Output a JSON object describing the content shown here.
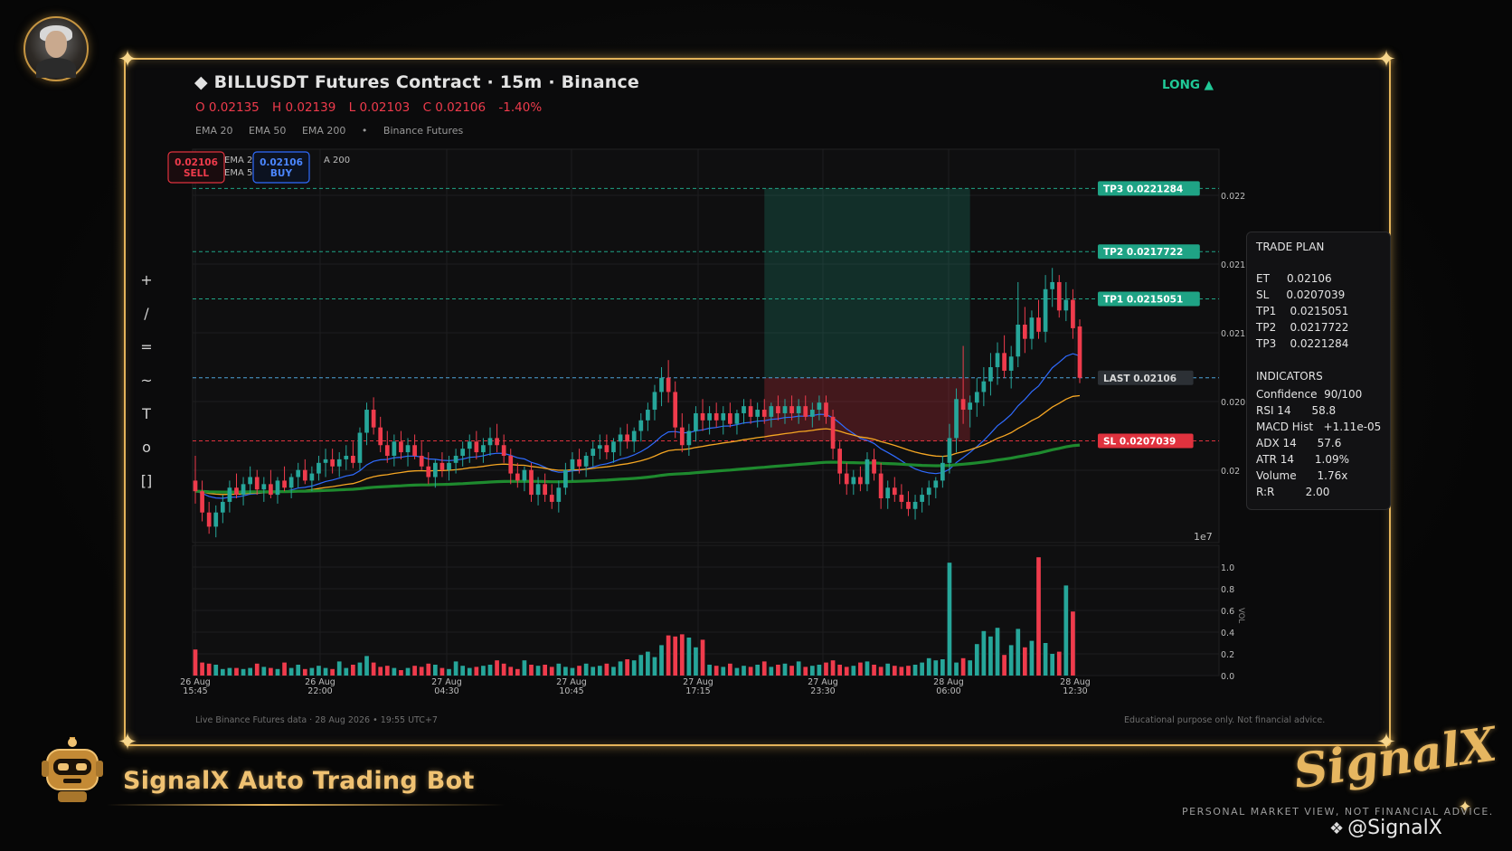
{
  "header": {
    "symbol_icon": "diamond-icon",
    "title": "◆  BILLUSDT Futures Contract  ·  15m  ·  Binance",
    "ohlc": {
      "open": "O 0.02135",
      "high": "H 0.02139",
      "low": "L 0.02103",
      "close": "C 0.02106",
      "change": "-1.40%"
    },
    "indicators": [
      "EMA 20",
      "EMA 50",
      "EMA 200",
      "•",
      "Binance Futures"
    ],
    "direction": "LONG  ▲"
  },
  "order_buttons": {
    "sell_price": "0.02106",
    "sell_label": "SELL",
    "buy_price": "0.02106",
    "buy_label": "BUY"
  },
  "legend_behind": [
    "EMA 2",
    "EMA 5",
    "A 200"
  ],
  "toolbar": [
    "+",
    "/",
    "=",
    "~",
    "T",
    "o",
    "[]"
  ],
  "levels": {
    "tp3": {
      "label": "TP3  0.0221284",
      "value": 0.0221284
    },
    "tp2": {
      "label": "TP2  0.0217722",
      "value": 0.0217722
    },
    "tp1": {
      "label": "TP1  0.0215051",
      "value": 0.0215051
    },
    "last": {
      "label": "LAST  0.02106",
      "value": 0.02106
    },
    "sl": {
      "label": "SL  0.0207039",
      "value": 0.0207039
    }
  },
  "trade_plan": {
    "title": "TRADE PLAN",
    "rows": [
      "ET     0.02106",
      "SL     0.0207039",
      "TP1    0.0215051",
      "TP2    0.0217722",
      "TP3    0.0221284"
    ],
    "indicators_title": "INDICATORS",
    "indicator_rows": [
      "Confidence  90/100",
      "RSI 14      58.8",
      "MACD Hist   +1.11e-05",
      "ADX 14      57.6",
      "ATR 14      1.09%",
      "Volume      1.76x",
      "R:R         2.00"
    ]
  },
  "footer": {
    "left": "Live Binance Futures data  ·  28 Aug 2026 • 19:55 UTC+7",
    "right": "Educational purpose only. Not financial advice."
  },
  "branding": {
    "icon": "robot-icon",
    "name": "SignalX Auto Trading Bot",
    "logo": "SignalX",
    "disclaimer": "PERSONAL MARKET VIEW, NOT FINANCIAL ADVICE.",
    "handle_icon": "binance-diamond-icon",
    "handle": "@SignalX"
  },
  "colors": {
    "up": "#26a69a",
    "down": "#ef3b4c",
    "ema20": "#2f6bff",
    "ema50": "#f5a623",
    "ema200": "#1e8a2e",
    "gold": "#e4b35a",
    "tp": "#1fa385",
    "sl": "#e0323e"
  },
  "chart_data": {
    "type": "candlestick",
    "title": "BILLUSDT Futures Contract · 15m · Binance",
    "x_tick_labels": [
      "26 Aug\n15:45",
      "26 Aug\n22:00",
      "27 Aug\n04:30",
      "27 Aug\n10:45",
      "27 Aug\n17:15",
      "27 Aug\n23:30",
      "28 Aug\n06:00",
      "28 Aug\n12:30"
    ],
    "y_tick_labels": [
      "0.022",
      "0.021",
      "0.021",
      "0.020",
      "0.02"
    ],
    "y_offset_label": "1e7",
    "y_range": [
      0.02013,
      0.02235
    ],
    "volume_ylabel": "VOL",
    "volume_tick_labels": [
      "1.0",
      "0.8",
      "0.6",
      "0.4",
      "0.2",
      "0.0"
    ],
    "volume_range": [
      0,
      1.0
    ],
    "position_box": {
      "entry": 0.02106,
      "stop": 0.0207039,
      "target": 0.0221284,
      "start_index": 83,
      "end_index": 113
    },
    "candles": [
      {
        "o": 0.02048,
        "h": 0.02062,
        "l": 0.02035,
        "c": 0.02042
      },
      {
        "o": 0.02042,
        "h": 0.02048,
        "l": 0.02025,
        "c": 0.0203
      },
      {
        "o": 0.0203,
        "h": 0.02036,
        "l": 0.02018,
        "c": 0.02022
      },
      {
        "o": 0.02022,
        "h": 0.02034,
        "l": 0.02016,
        "c": 0.0203
      },
      {
        "o": 0.0203,
        "h": 0.0204,
        "l": 0.02024,
        "c": 0.02036
      },
      {
        "o": 0.02036,
        "h": 0.02048,
        "l": 0.0203,
        "c": 0.02044
      },
      {
        "o": 0.02044,
        "h": 0.02052,
        "l": 0.02038,
        "c": 0.0204
      },
      {
        "o": 0.0204,
        "h": 0.0205,
        "l": 0.02034,
        "c": 0.02046
      },
      {
        "o": 0.02046,
        "h": 0.02056,
        "l": 0.0204,
        "c": 0.0205
      },
      {
        "o": 0.0205,
        "h": 0.02054,
        "l": 0.0204,
        "c": 0.02043
      },
      {
        "o": 0.02043,
        "h": 0.0205,
        "l": 0.02036,
        "c": 0.02046
      },
      {
        "o": 0.02046,
        "h": 0.02054,
        "l": 0.02038,
        "c": 0.0204
      },
      {
        "o": 0.0204,
        "h": 0.0205,
        "l": 0.02035,
        "c": 0.02048
      },
      {
        "o": 0.02048,
        "h": 0.02056,
        "l": 0.02042,
        "c": 0.02044
      },
      {
        "o": 0.02044,
        "h": 0.02052,
        "l": 0.02038,
        "c": 0.0205
      },
      {
        "o": 0.0205,
        "h": 0.02058,
        "l": 0.02044,
        "c": 0.02054
      },
      {
        "o": 0.02054,
        "h": 0.0206,
        "l": 0.02046,
        "c": 0.02048
      },
      {
        "o": 0.02048,
        "h": 0.02056,
        "l": 0.02042,
        "c": 0.02052
      },
      {
        "o": 0.02052,
        "h": 0.02062,
        "l": 0.02048,
        "c": 0.02058
      },
      {
        "o": 0.02058,
        "h": 0.02066,
        "l": 0.0205,
        "c": 0.0206
      },
      {
        "o": 0.0206,
        "h": 0.02066,
        "l": 0.02052,
        "c": 0.02056
      },
      {
        "o": 0.02056,
        "h": 0.02064,
        "l": 0.0205,
        "c": 0.0206
      },
      {
        "o": 0.0206,
        "h": 0.02068,
        "l": 0.02054,
        "c": 0.02062
      },
      {
        "o": 0.02062,
        "h": 0.0207,
        "l": 0.02055,
        "c": 0.02058
      },
      {
        "o": 0.02058,
        "h": 0.02078,
        "l": 0.02054,
        "c": 0.02075
      },
      {
        "o": 0.02075,
        "h": 0.02092,
        "l": 0.02068,
        "c": 0.02088
      },
      {
        "o": 0.02088,
        "h": 0.02095,
        "l": 0.02074,
        "c": 0.02078
      },
      {
        "o": 0.02078,
        "h": 0.02084,
        "l": 0.02064,
        "c": 0.02068
      },
      {
        "o": 0.02068,
        "h": 0.02076,
        "l": 0.02058,
        "c": 0.02062
      },
      {
        "o": 0.02062,
        "h": 0.02074,
        "l": 0.02056,
        "c": 0.0207
      },
      {
        "o": 0.0207,
        "h": 0.02076,
        "l": 0.0206,
        "c": 0.02064
      },
      {
        "o": 0.02064,
        "h": 0.02072,
        "l": 0.02056,
        "c": 0.02068
      },
      {
        "o": 0.02068,
        "h": 0.02074,
        "l": 0.0206,
        "c": 0.02062
      },
      {
        "o": 0.02062,
        "h": 0.0207,
        "l": 0.02054,
        "c": 0.02056
      },
      {
        "o": 0.02056,
        "h": 0.02064,
        "l": 0.02046,
        "c": 0.0205
      },
      {
        "o": 0.0205,
        "h": 0.0206,
        "l": 0.02044,
        "c": 0.02058
      },
      {
        "o": 0.02058,
        "h": 0.02064,
        "l": 0.0205,
        "c": 0.02054
      },
      {
        "o": 0.02054,
        "h": 0.02062,
        "l": 0.02048,
        "c": 0.02058
      },
      {
        "o": 0.02058,
        "h": 0.02066,
        "l": 0.02052,
        "c": 0.02062
      },
      {
        "o": 0.02062,
        "h": 0.0207,
        "l": 0.02056,
        "c": 0.02066
      },
      {
        "o": 0.02066,
        "h": 0.02074,
        "l": 0.02058,
        "c": 0.0207
      },
      {
        "o": 0.0207,
        "h": 0.02076,
        "l": 0.0206,
        "c": 0.02064
      },
      {
        "o": 0.02064,
        "h": 0.02072,
        "l": 0.02058,
        "c": 0.02068
      },
      {
        "o": 0.02068,
        "h": 0.02078,
        "l": 0.02062,
        "c": 0.02072
      },
      {
        "o": 0.02072,
        "h": 0.0208,
        "l": 0.02064,
        "c": 0.02068
      },
      {
        "o": 0.02068,
        "h": 0.02074,
        "l": 0.02058,
        "c": 0.02062
      },
      {
        "o": 0.02062,
        "h": 0.02066,
        "l": 0.02046,
        "c": 0.02052
      },
      {
        "o": 0.02052,
        "h": 0.02058,
        "l": 0.02044,
        "c": 0.02048
      },
      {
        "o": 0.02048,
        "h": 0.02056,
        "l": 0.02042,
        "c": 0.02054
      },
      {
        "o": 0.02054,
        "h": 0.02058,
        "l": 0.02036,
        "c": 0.0204
      },
      {
        "o": 0.0204,
        "h": 0.0205,
        "l": 0.02034,
        "c": 0.02046
      },
      {
        "o": 0.02046,
        "h": 0.02052,
        "l": 0.02036,
        "c": 0.0204
      },
      {
        "o": 0.0204,
        "h": 0.02046,
        "l": 0.02032,
        "c": 0.02036
      },
      {
        "o": 0.02036,
        "h": 0.02048,
        "l": 0.0203,
        "c": 0.02044
      },
      {
        "o": 0.02044,
        "h": 0.02058,
        "l": 0.0204,
        "c": 0.02054
      },
      {
        "o": 0.02054,
        "h": 0.02064,
        "l": 0.02048,
        "c": 0.0206
      },
      {
        "o": 0.0206,
        "h": 0.02066,
        "l": 0.02052,
        "c": 0.02056
      },
      {
        "o": 0.02056,
        "h": 0.02064,
        "l": 0.0205,
        "c": 0.02062
      },
      {
        "o": 0.02062,
        "h": 0.0207,
        "l": 0.02056,
        "c": 0.02066
      },
      {
        "o": 0.02066,
        "h": 0.02074,
        "l": 0.0206,
        "c": 0.02068
      },
      {
        "o": 0.02068,
        "h": 0.02074,
        "l": 0.0206,
        "c": 0.02064
      },
      {
        "o": 0.02064,
        "h": 0.02072,
        "l": 0.02058,
        "c": 0.0207
      },
      {
        "o": 0.0207,
        "h": 0.02078,
        "l": 0.02062,
        "c": 0.02074
      },
      {
        "o": 0.02074,
        "h": 0.0208,
        "l": 0.02066,
        "c": 0.0207
      },
      {
        "o": 0.0207,
        "h": 0.02078,
        "l": 0.02064,
        "c": 0.02076
      },
      {
        "o": 0.02076,
        "h": 0.02086,
        "l": 0.0207,
        "c": 0.02082
      },
      {
        "o": 0.02082,
        "h": 0.02092,
        "l": 0.02076,
        "c": 0.02088
      },
      {
        "o": 0.02088,
        "h": 0.02102,
        "l": 0.02082,
        "c": 0.02098
      },
      {
        "o": 0.02098,
        "h": 0.02112,
        "l": 0.0209,
        "c": 0.02106
      },
      {
        "o": 0.02106,
        "h": 0.02116,
        "l": 0.02092,
        "c": 0.02098
      },
      {
        "o": 0.02098,
        "h": 0.02104,
        "l": 0.02072,
        "c": 0.02078
      },
      {
        "o": 0.02078,
        "h": 0.02086,
        "l": 0.02064,
        "c": 0.02068
      },
      {
        "o": 0.02068,
        "h": 0.0208,
        "l": 0.02062,
        "c": 0.02076
      },
      {
        "o": 0.02076,
        "h": 0.0209,
        "l": 0.0207,
        "c": 0.02086
      },
      {
        "o": 0.02086,
        "h": 0.02094,
        "l": 0.02076,
        "c": 0.02082
      },
      {
        "o": 0.02082,
        "h": 0.0209,
        "l": 0.02074,
        "c": 0.02086
      },
      {
        "o": 0.02086,
        "h": 0.02092,
        "l": 0.02078,
        "c": 0.02082
      },
      {
        "o": 0.02082,
        "h": 0.0209,
        "l": 0.02074,
        "c": 0.02086
      },
      {
        "o": 0.02086,
        "h": 0.02092,
        "l": 0.02078,
        "c": 0.0208
      },
      {
        "o": 0.0208,
        "h": 0.02088,
        "l": 0.02074,
        "c": 0.02086
      },
      {
        "o": 0.02086,
        "h": 0.02094,
        "l": 0.0208,
        "c": 0.0209
      },
      {
        "o": 0.0209,
        "h": 0.02094,
        "l": 0.0208,
        "c": 0.02084
      },
      {
        "o": 0.02084,
        "h": 0.02092,
        "l": 0.02078,
        "c": 0.02088
      },
      {
        "o": 0.02088,
        "h": 0.02094,
        "l": 0.0208,
        "c": 0.02084
      },
      {
        "o": 0.02084,
        "h": 0.02092,
        "l": 0.02078,
        "c": 0.0209
      },
      {
        "o": 0.0209,
        "h": 0.02096,
        "l": 0.02082,
        "c": 0.02086
      },
      {
        "o": 0.02086,
        "h": 0.02094,
        "l": 0.0208,
        "c": 0.0209
      },
      {
        "o": 0.0209,
        "h": 0.02096,
        "l": 0.02082,
        "c": 0.02086
      },
      {
        "o": 0.02086,
        "h": 0.02094,
        "l": 0.0208,
        "c": 0.0209
      },
      {
        "o": 0.0209,
        "h": 0.02096,
        "l": 0.02082,
        "c": 0.02084
      },
      {
        "o": 0.02084,
        "h": 0.02092,
        "l": 0.02078,
        "c": 0.02088
      },
      {
        "o": 0.02088,
        "h": 0.02096,
        "l": 0.02082,
        "c": 0.02092
      },
      {
        "o": 0.02092,
        "h": 0.02096,
        "l": 0.0208,
        "c": 0.02084
      },
      {
        "o": 0.02084,
        "h": 0.02088,
        "l": 0.0206,
        "c": 0.02066
      },
      {
        "o": 0.02066,
        "h": 0.0207,
        "l": 0.02046,
        "c": 0.02052
      },
      {
        "o": 0.02052,
        "h": 0.02058,
        "l": 0.0204,
        "c": 0.02046
      },
      {
        "o": 0.02046,
        "h": 0.02054,
        "l": 0.0204,
        "c": 0.0205
      },
      {
        "o": 0.0205,
        "h": 0.02056,
        "l": 0.02042,
        "c": 0.02046
      },
      {
        "o": 0.02046,
        "h": 0.02064,
        "l": 0.02042,
        "c": 0.0206
      },
      {
        "o": 0.0206,
        "h": 0.02066,
        "l": 0.02048,
        "c": 0.02052
      },
      {
        "o": 0.02052,
        "h": 0.02058,
        "l": 0.02032,
        "c": 0.02038
      },
      {
        "o": 0.02038,
        "h": 0.02048,
        "l": 0.02032,
        "c": 0.02044
      },
      {
        "o": 0.02044,
        "h": 0.0205,
        "l": 0.02036,
        "c": 0.0204
      },
      {
        "o": 0.0204,
        "h": 0.02046,
        "l": 0.02032,
        "c": 0.02036
      },
      {
        "o": 0.02036,
        "h": 0.02042,
        "l": 0.02028,
        "c": 0.02032
      },
      {
        "o": 0.02032,
        "h": 0.0204,
        "l": 0.02026,
        "c": 0.02036
      },
      {
        "o": 0.02036,
        "h": 0.02044,
        "l": 0.0203,
        "c": 0.0204
      },
      {
        "o": 0.0204,
        "h": 0.02048,
        "l": 0.02034,
        "c": 0.02044
      },
      {
        "o": 0.02044,
        "h": 0.0205,
        "l": 0.02038,
        "c": 0.02048
      },
      {
        "o": 0.02048,
        "h": 0.02062,
        "l": 0.02044,
        "c": 0.02058
      },
      {
        "o": 0.02058,
        "h": 0.0208,
        "l": 0.02052,
        "c": 0.02072
      },
      {
        "o": 0.02072,
        "h": 0.021,
        "l": 0.02064,
        "c": 0.02094
      },
      {
        "o": 0.02094,
        "h": 0.02124,
        "l": 0.0208,
        "c": 0.02088
      },
      {
        "o": 0.02088,
        "h": 0.02096,
        "l": 0.02078,
        "c": 0.02092
      },
      {
        "o": 0.02092,
        "h": 0.02106,
        "l": 0.02084,
        "c": 0.02098
      },
      {
        "o": 0.02098,
        "h": 0.02112,
        "l": 0.0209,
        "c": 0.02104
      },
      {
        "o": 0.02104,
        "h": 0.0212,
        "l": 0.02096,
        "c": 0.02112
      },
      {
        "o": 0.02112,
        "h": 0.02126,
        "l": 0.02102,
        "c": 0.0212
      },
      {
        "o": 0.0212,
        "h": 0.0213,
        "l": 0.02106,
        "c": 0.0211
      },
      {
        "o": 0.0211,
        "h": 0.02124,
        "l": 0.021,
        "c": 0.02118
      },
      {
        "o": 0.02118,
        "h": 0.0216,
        "l": 0.02112,
        "c": 0.02136
      },
      {
        "o": 0.02136,
        "h": 0.02146,
        "l": 0.0212,
        "c": 0.02128
      },
      {
        "o": 0.02128,
        "h": 0.02144,
        "l": 0.02122,
        "c": 0.0214
      },
      {
        "o": 0.0214,
        "h": 0.0215,
        "l": 0.02128,
        "c": 0.02132
      },
      {
        "o": 0.02132,
        "h": 0.02164,
        "l": 0.02126,
        "c": 0.02156
      },
      {
        "o": 0.02156,
        "h": 0.02168,
        "l": 0.02146,
        "c": 0.0216
      },
      {
        "o": 0.0216,
        "h": 0.02164,
        "l": 0.0214,
        "c": 0.02144
      },
      {
        "o": 0.02144,
        "h": 0.0216,
        "l": 0.02138,
        "c": 0.0215
      },
      {
        "o": 0.0215,
        "h": 0.02156,
        "l": 0.02128,
        "c": 0.02134
      },
      {
        "o": 0.02135,
        "h": 0.02139,
        "l": 0.02103,
        "c": 0.02106
      }
    ],
    "volumes": [
      0.24,
      0.12,
      0.11,
      0.1,
      0.06,
      0.07,
      0.07,
      0.06,
      0.07,
      0.11,
      0.08,
      0.07,
      0.06,
      0.12,
      0.07,
      0.1,
      0.06,
      0.07,
      0.09,
      0.07,
      0.06,
      0.13,
      0.07,
      0.1,
      0.12,
      0.18,
      0.12,
      0.08,
      0.09,
      0.07,
      0.05,
      0.07,
      0.09,
      0.08,
      0.11,
      0.1,
      0.07,
      0.06,
      0.13,
      0.09,
      0.07,
      0.08,
      0.09,
      0.1,
      0.14,
      0.11,
      0.08,
      0.06,
      0.14,
      0.1,
      0.09,
      0.1,
      0.08,
      0.11,
      0.08,
      0.07,
      0.09,
      0.11,
      0.08,
      0.09,
      0.11,
      0.08,
      0.13,
      0.15,
      0.14,
      0.19,
      0.22,
      0.17,
      0.28,
      0.37,
      0.36,
      0.38,
      0.35,
      0.26,
      0.33,
      0.1,
      0.09,
      0.08,
      0.11,
      0.07,
      0.09,
      0.08,
      0.1,
      0.13,
      0.08,
      0.1,
      0.11,
      0.09,
      0.13,
      0.08,
      0.09,
      0.1,
      0.12,
      0.14,
      0.1,
      0.08,
      0.09,
      0.12,
      0.13,
      0.1,
      0.08,
      0.11,
      0.09,
      0.08,
      0.09,
      0.1,
      0.12,
      0.16,
      0.14,
      0.15,
      1.04,
      0.12,
      0.16,
      0.14,
      0.29,
      0.41,
      0.36,
      0.44,
      0.19,
      0.28,
      0.43,
      0.26,
      0.32,
      1.09,
      0.3,
      0.2,
      0.22,
      0.83,
      0.59
    ]
  }
}
